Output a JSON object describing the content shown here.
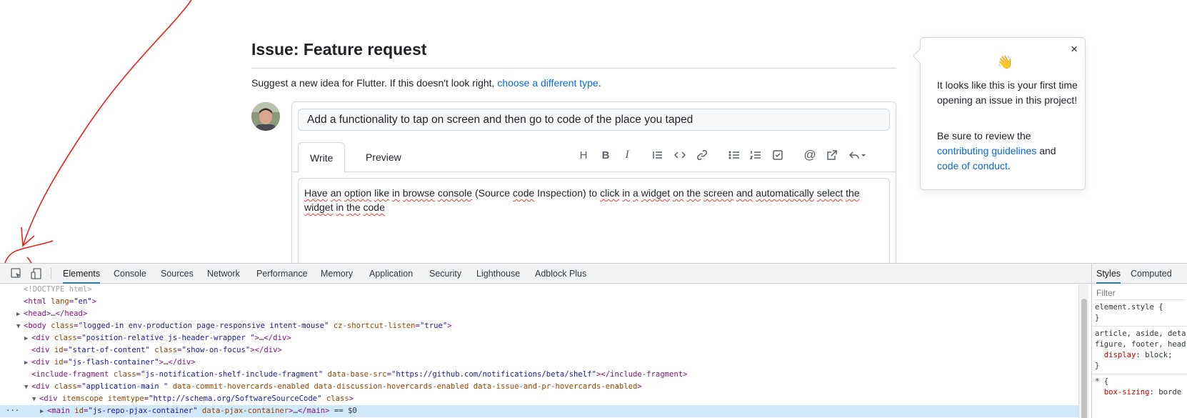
{
  "page": {
    "title": "Issue: Feature request",
    "subtitle_prefix": "Suggest a new idea for Flutter. If this doesn't look right, ",
    "subtitle_link": "choose a different type",
    "subtitle_suffix": "."
  },
  "editor": {
    "title_value": "Add a functionality to tap on screen and then go to code of the place you taped",
    "tabs": [
      "Write",
      "Preview"
    ],
    "toolbar_icons": [
      "heading-icon",
      "bold-icon",
      "italic-icon",
      "quote-icon",
      "code-icon",
      "link-icon",
      "bulleted-list-icon",
      "numbered-list-icon",
      "task-list-icon",
      "mention-icon",
      "reference-icon",
      "saved-replies-icon"
    ],
    "toolbar_labels": {
      "heading": "H",
      "bold": "B",
      "italic": "I",
      "mention": "@"
    },
    "body_words": [
      "Have",
      "an",
      "option",
      "like",
      "in",
      "browse",
      "console",
      "(Source",
      "code",
      "Inspection)",
      "to",
      "click",
      "in",
      "a",
      "widget",
      "on",
      "the",
      "screen",
      "and",
      "automatically",
      "select",
      "the",
      "widget",
      "in",
      "the",
      "code"
    ]
  },
  "popover": {
    "close": "×",
    "wave": "👋",
    "text1": "It looks like this is your first time opening an issue in this project!",
    "text2_prefix": "Be sure to review the ",
    "link1": "contributing guidelines",
    "text2_middle": " and ",
    "link2": "code of conduct",
    "text2_suffix": "."
  },
  "devtools": {
    "tabs": [
      "Elements",
      "Console",
      "Sources",
      "Network",
      "Performance",
      "Memory",
      "Application",
      "Security",
      "Lighthouse",
      "Adblock Plus"
    ],
    "active_tab": "Elements",
    "side_tabs": [
      "Styles",
      "Computed"
    ],
    "filter_placeholder": "Filter",
    "styles_lines": [
      [
        "element.style {",
        "}"
      ],
      [
        "article, aside, deta",
        "figure, footer, head",
        "  display: block;",
        "}"
      ],
      [
        "* {",
        "  box-sizing: borde"
      ]
    ],
    "dom_lines": [
      {
        "indent": 2,
        "arrow": "",
        "html": "<!DOCTYPE html>",
        "kind": "doctype"
      },
      {
        "indent": 2,
        "arrow": "",
        "open": "html",
        "attrs": [
          [
            "lang",
            "en"
          ]
        ],
        "close": false
      },
      {
        "indent": 2,
        "arrow": "▶",
        "open": "head",
        "collapsed": true
      },
      {
        "indent": 2,
        "arrow": "▼",
        "open": "body",
        "attrs": [
          [
            "class",
            "logged-in env-production page-responsive intent-mouse"
          ],
          [
            "cz-shortcut-listen",
            "true"
          ]
        ]
      },
      {
        "indent": 4,
        "arrow": "▶",
        "open": "div",
        "attrs": [
          [
            "class",
            "position-relative js-header-wrapper "
          ]
        ],
        "collapsed": true
      },
      {
        "indent": 4,
        "arrow": "",
        "open": "div",
        "attrs": [
          [
            "id",
            "start-of-content"
          ],
          [
            "class",
            "show-on-focus"
          ]
        ],
        "empty": true
      },
      {
        "indent": 4,
        "arrow": "▶",
        "open": "div",
        "attrs": [
          [
            "id",
            "js-flash-container"
          ]
        ],
        "collapsed": true
      },
      {
        "indent": 4,
        "arrow": "",
        "open": "include-fragment",
        "attrs": [
          [
            "class",
            "js-notification-shelf-include-fragment"
          ],
          [
            "data-base-src",
            "https://github.com/notifications/beta/shelf"
          ]
        ],
        "empty": true
      },
      {
        "indent": 4,
        "arrow": "▼",
        "open": "div",
        "attrs": [
          [
            "class",
            "application-main "
          ],
          [
            "data-commit-hovercards-enabled",
            null
          ],
          [
            "data-discussion-hovercards-enabled",
            null
          ],
          [
            "data-issue-and-pr-hovercards-enabled",
            null
          ]
        ]
      },
      {
        "indent": 6,
        "arrow": "▼",
        "open": "div",
        "attrs": [
          [
            "itemscope",
            null
          ],
          [
            "itemtype",
            "http://schema.org/SoftwareSourceCode"
          ],
          [
            "class",
            null
          ]
        ]
      },
      {
        "indent": 8,
        "arrow": "▶",
        "open": "main",
        "attrs": [
          [
            "id",
            "js-repo-pjax-container"
          ],
          [
            "data-pjax-container",
            null
          ]
        ],
        "collapsed": true,
        "selected": true,
        "suffix": " == $0"
      }
    ],
    "dots": "···"
  },
  "colors": {
    "link": "#0969da",
    "devtools_accent": "#1a73e8",
    "annotation": "#e8221c",
    "selected_row": "#cfe8fc"
  }
}
